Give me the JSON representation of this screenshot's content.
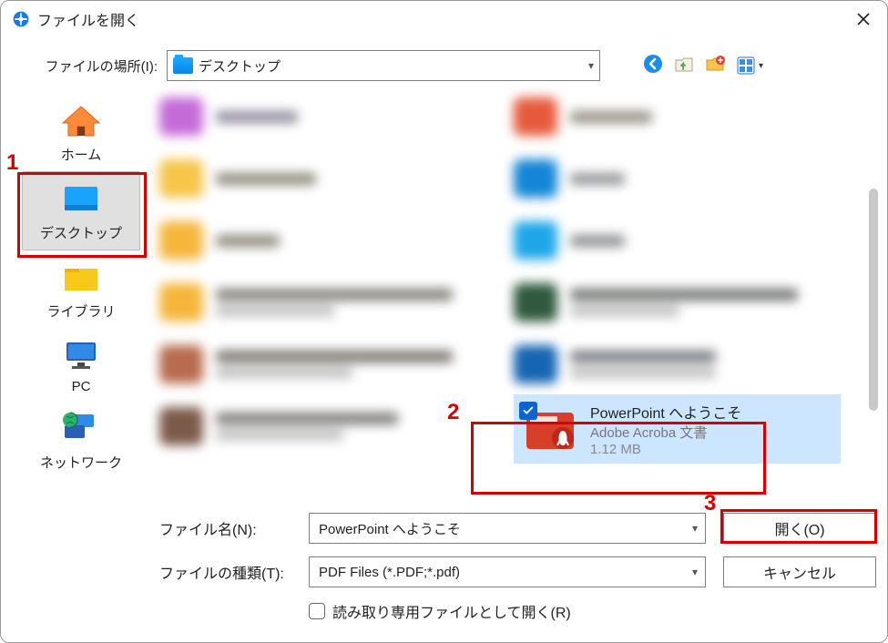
{
  "window": {
    "title": "ファイルを開く"
  },
  "location": {
    "label": "ファイルの場所(I):",
    "current": "デスクトップ"
  },
  "sidebar": {
    "items": [
      {
        "key": "home",
        "label": "ホーム"
      },
      {
        "key": "desktop",
        "label": "デスクトップ"
      },
      {
        "key": "libraries",
        "label": "ライブラリ"
      },
      {
        "key": "pc",
        "label": "PC"
      },
      {
        "key": "network",
        "label": "ネットワーク"
      }
    ],
    "selected": "desktop"
  },
  "selected_file": {
    "name": "PowerPoint へようこそ",
    "type_label": "Adobe Acroba 文書",
    "size_label": "1.12 MB"
  },
  "footer": {
    "filename_label": "ファイル名(N):",
    "filename_value": "PowerPoint へようこそ",
    "filetype_label": "ファイルの種類(T):",
    "filetype_value": "PDF Files (*.PDF;*.pdf)",
    "open_button": "開く(O)",
    "cancel_button": "キャンセル",
    "readonly_label": "読み取り専用ファイルとして開く(R)"
  },
  "annotations": {
    "one": "1",
    "two": "2",
    "three": "3"
  },
  "blurred_items": {
    "left": [
      {
        "thumb": "#c56bd9",
        "text": "#928c9e",
        "w1": 90,
        "w2": 0
      },
      {
        "thumb": "#f6c549",
        "text": "#90897a",
        "w1": 110,
        "w2": 0
      },
      {
        "thumb": "#f6b63c",
        "text": "#8f897e",
        "w1": 70,
        "w2": 0
      },
      {
        "thumb": "#f6b63c",
        "text": "#837f78",
        "w1": 260,
        "w2": 130
      },
      {
        "thumb": "#b86b4e",
        "text": "#7a746d",
        "w1": 260,
        "w2": 150
      },
      {
        "thumb": "#7c5a49",
        "text": "#7d7b77",
        "w1": 200,
        "w2": 140
      }
    ],
    "right": [
      {
        "thumb": "#e65a3c",
        "text": "#968e83",
        "w1": 90,
        "w2": 0
      },
      {
        "thumb": "#1386d6",
        "text": "#90949a",
        "w1": 60,
        "w2": 0
      },
      {
        "thumb": "#1ea6e8",
        "text": "#8d8f93",
        "w1": 60,
        "w2": 0
      },
      {
        "thumb": "#2f5a3f",
        "text": "#707571",
        "w1": 250,
        "w2": 120
      },
      {
        "thumb": "#1565b3",
        "text": "#767b82",
        "w1": 160,
        "w2": 160
      }
    ]
  }
}
